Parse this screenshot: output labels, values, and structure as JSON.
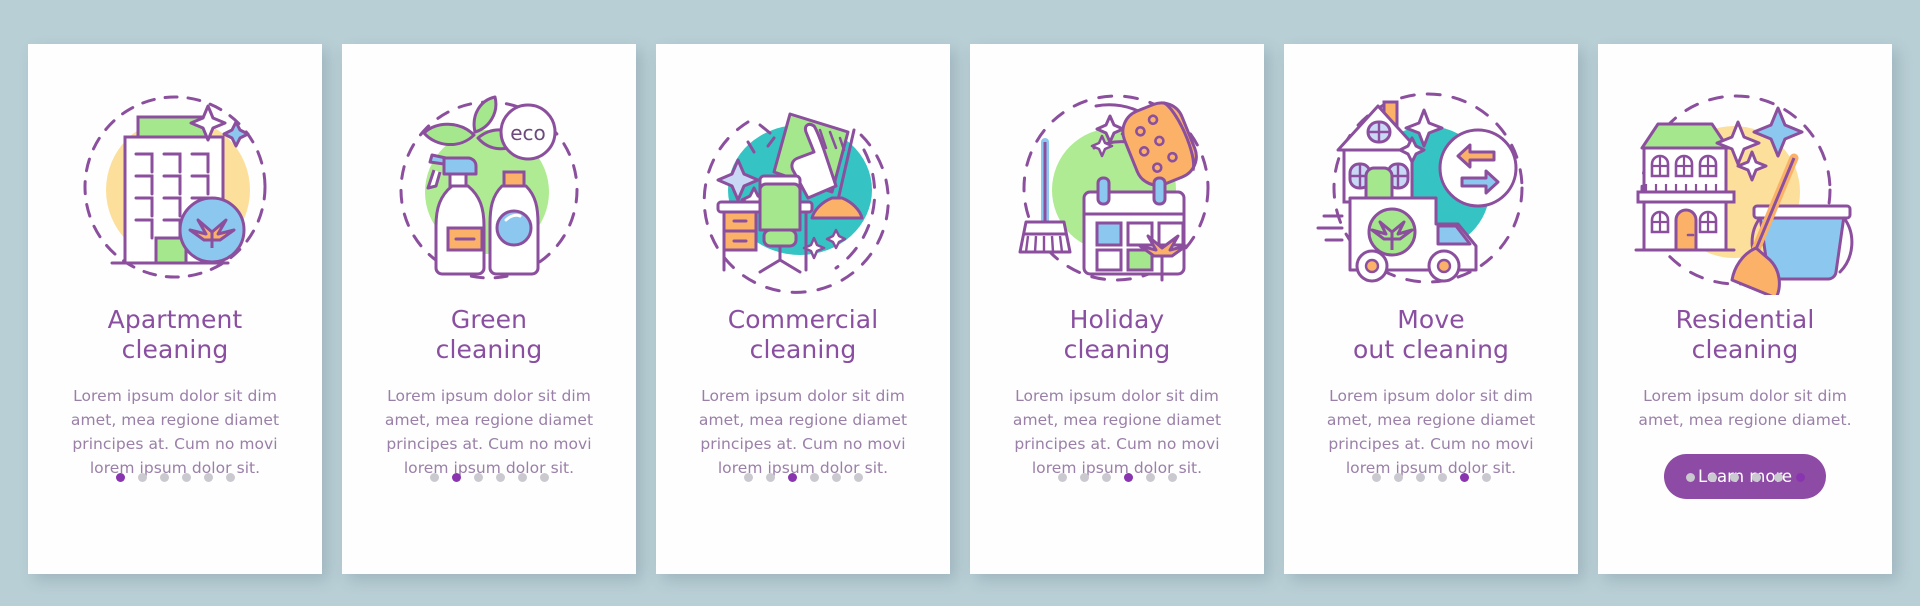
{
  "background_color": "#b9cfd6",
  "card_background": "#fefefe",
  "accent_color": "#8a4fa0",
  "button_color": "#8e4ba5",
  "dot_active_color": "#8a35b0",
  "dot_inactive_color": "#c9c9cf",
  "total_steps": 6,
  "cards": [
    {
      "id": "apartment-cleaning",
      "illustration": "apartment-building-icon",
      "title_line1": "Apartment",
      "title_line2": "cleaning",
      "description": "Lorem ipsum dolor sit dim amet, mea regione diamet principes at. Cum no movi lorem ipsum dolor sit.",
      "active_dot": 1,
      "button_label": null
    },
    {
      "id": "green-cleaning",
      "illustration": "eco-spray-bottles-icon",
      "badge_text": "eco",
      "title_line1": "Green",
      "title_line2": "cleaning",
      "description": "Lorem ipsum dolor sit dim amet, mea regione diamet principes at. Cum no movi lorem ipsum dolor sit.",
      "active_dot": 2,
      "button_label": null
    },
    {
      "id": "commercial-cleaning",
      "illustration": "office-desk-mop-icon",
      "title_line1": "Commercial",
      "title_line2": "cleaning",
      "description": "Lorem ipsum dolor sit dim amet, mea regione diamet principes at. Cum no movi lorem ipsum dolor sit.",
      "active_dot": 3,
      "button_label": null
    },
    {
      "id": "holiday-cleaning",
      "illustration": "calendar-sponge-broom-icon",
      "title_line1": "Holiday",
      "title_line2": "cleaning",
      "description": "Lorem ipsum dolor sit dim amet, mea regione diamet principes at. Cum no movi lorem ipsum dolor sit.",
      "active_dot": 4,
      "button_label": null
    },
    {
      "id": "move-out-cleaning",
      "illustration": "house-moving-truck-icon",
      "title_line1": "Move",
      "title_line2": "out cleaning",
      "description": "Lorem ipsum dolor sit dim amet, mea regione diamet principes at. Cum no movi lorem ipsum dolor sit.",
      "active_dot": 5,
      "button_label": null
    },
    {
      "id": "residential-cleaning",
      "illustration": "house-bucket-broom-icon",
      "title_line1": "Residential",
      "title_line2": "cleaning",
      "description": "Lorem ipsum dolor sit dim amet, mea regione diamet.",
      "active_dot": 6,
      "button_label": "Learn more"
    }
  ]
}
